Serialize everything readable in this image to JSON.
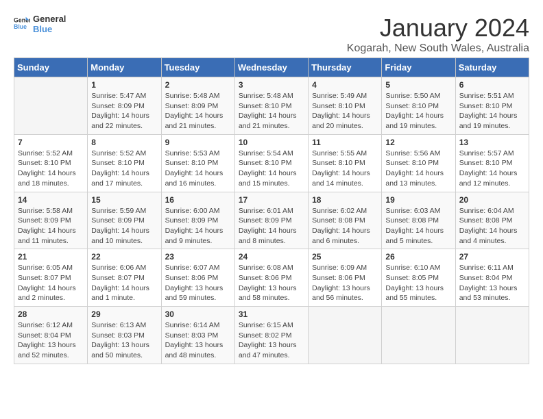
{
  "logo": {
    "line1": "General",
    "line2": "Blue"
  },
  "title": "January 2024",
  "subtitle": "Kogarah, New South Wales, Australia",
  "headers": [
    "Sunday",
    "Monday",
    "Tuesday",
    "Wednesday",
    "Thursday",
    "Friday",
    "Saturday"
  ],
  "weeks": [
    [
      {
        "day": "",
        "info": ""
      },
      {
        "day": "1",
        "info": "Sunrise: 5:47 AM\nSunset: 8:09 PM\nDaylight: 14 hours\nand 22 minutes."
      },
      {
        "day": "2",
        "info": "Sunrise: 5:48 AM\nSunset: 8:09 PM\nDaylight: 14 hours\nand 21 minutes."
      },
      {
        "day": "3",
        "info": "Sunrise: 5:48 AM\nSunset: 8:10 PM\nDaylight: 14 hours\nand 21 minutes."
      },
      {
        "day": "4",
        "info": "Sunrise: 5:49 AM\nSunset: 8:10 PM\nDaylight: 14 hours\nand 20 minutes."
      },
      {
        "day": "5",
        "info": "Sunrise: 5:50 AM\nSunset: 8:10 PM\nDaylight: 14 hours\nand 19 minutes."
      },
      {
        "day": "6",
        "info": "Sunrise: 5:51 AM\nSunset: 8:10 PM\nDaylight: 14 hours\nand 19 minutes."
      }
    ],
    [
      {
        "day": "7",
        "info": "Sunrise: 5:52 AM\nSunset: 8:10 PM\nDaylight: 14 hours\nand 18 minutes."
      },
      {
        "day": "8",
        "info": "Sunrise: 5:52 AM\nSunset: 8:10 PM\nDaylight: 14 hours\nand 17 minutes."
      },
      {
        "day": "9",
        "info": "Sunrise: 5:53 AM\nSunset: 8:10 PM\nDaylight: 14 hours\nand 16 minutes."
      },
      {
        "day": "10",
        "info": "Sunrise: 5:54 AM\nSunset: 8:10 PM\nDaylight: 14 hours\nand 15 minutes."
      },
      {
        "day": "11",
        "info": "Sunrise: 5:55 AM\nSunset: 8:10 PM\nDaylight: 14 hours\nand 14 minutes."
      },
      {
        "day": "12",
        "info": "Sunrise: 5:56 AM\nSunset: 8:10 PM\nDaylight: 14 hours\nand 13 minutes."
      },
      {
        "day": "13",
        "info": "Sunrise: 5:57 AM\nSunset: 8:10 PM\nDaylight: 14 hours\nand 12 minutes."
      }
    ],
    [
      {
        "day": "14",
        "info": "Sunrise: 5:58 AM\nSunset: 8:09 PM\nDaylight: 14 hours\nand 11 minutes."
      },
      {
        "day": "15",
        "info": "Sunrise: 5:59 AM\nSunset: 8:09 PM\nDaylight: 14 hours\nand 10 minutes."
      },
      {
        "day": "16",
        "info": "Sunrise: 6:00 AM\nSunset: 8:09 PM\nDaylight: 14 hours\nand 9 minutes."
      },
      {
        "day": "17",
        "info": "Sunrise: 6:01 AM\nSunset: 8:09 PM\nDaylight: 14 hours\nand 8 minutes."
      },
      {
        "day": "18",
        "info": "Sunrise: 6:02 AM\nSunset: 8:08 PM\nDaylight: 14 hours\nand 6 minutes."
      },
      {
        "day": "19",
        "info": "Sunrise: 6:03 AM\nSunset: 8:08 PM\nDaylight: 14 hours\nand 5 minutes."
      },
      {
        "day": "20",
        "info": "Sunrise: 6:04 AM\nSunset: 8:08 PM\nDaylight: 14 hours\nand 4 minutes."
      }
    ],
    [
      {
        "day": "21",
        "info": "Sunrise: 6:05 AM\nSunset: 8:07 PM\nDaylight: 14 hours\nand 2 minutes."
      },
      {
        "day": "22",
        "info": "Sunrise: 6:06 AM\nSunset: 8:07 PM\nDaylight: 14 hours\nand 1 minute."
      },
      {
        "day": "23",
        "info": "Sunrise: 6:07 AM\nSunset: 8:06 PM\nDaylight: 13 hours\nand 59 minutes."
      },
      {
        "day": "24",
        "info": "Sunrise: 6:08 AM\nSunset: 8:06 PM\nDaylight: 13 hours\nand 58 minutes."
      },
      {
        "day": "25",
        "info": "Sunrise: 6:09 AM\nSunset: 8:06 PM\nDaylight: 13 hours\nand 56 minutes."
      },
      {
        "day": "26",
        "info": "Sunrise: 6:10 AM\nSunset: 8:05 PM\nDaylight: 13 hours\nand 55 minutes."
      },
      {
        "day": "27",
        "info": "Sunrise: 6:11 AM\nSunset: 8:04 PM\nDaylight: 13 hours\nand 53 minutes."
      }
    ],
    [
      {
        "day": "28",
        "info": "Sunrise: 6:12 AM\nSunset: 8:04 PM\nDaylight: 13 hours\nand 52 minutes."
      },
      {
        "day": "29",
        "info": "Sunrise: 6:13 AM\nSunset: 8:03 PM\nDaylight: 13 hours\nand 50 minutes."
      },
      {
        "day": "30",
        "info": "Sunrise: 6:14 AM\nSunset: 8:03 PM\nDaylight: 13 hours\nand 48 minutes."
      },
      {
        "day": "31",
        "info": "Sunrise: 6:15 AM\nSunset: 8:02 PM\nDaylight: 13 hours\nand 47 minutes."
      },
      {
        "day": "",
        "info": ""
      },
      {
        "day": "",
        "info": ""
      },
      {
        "day": "",
        "info": ""
      }
    ]
  ]
}
